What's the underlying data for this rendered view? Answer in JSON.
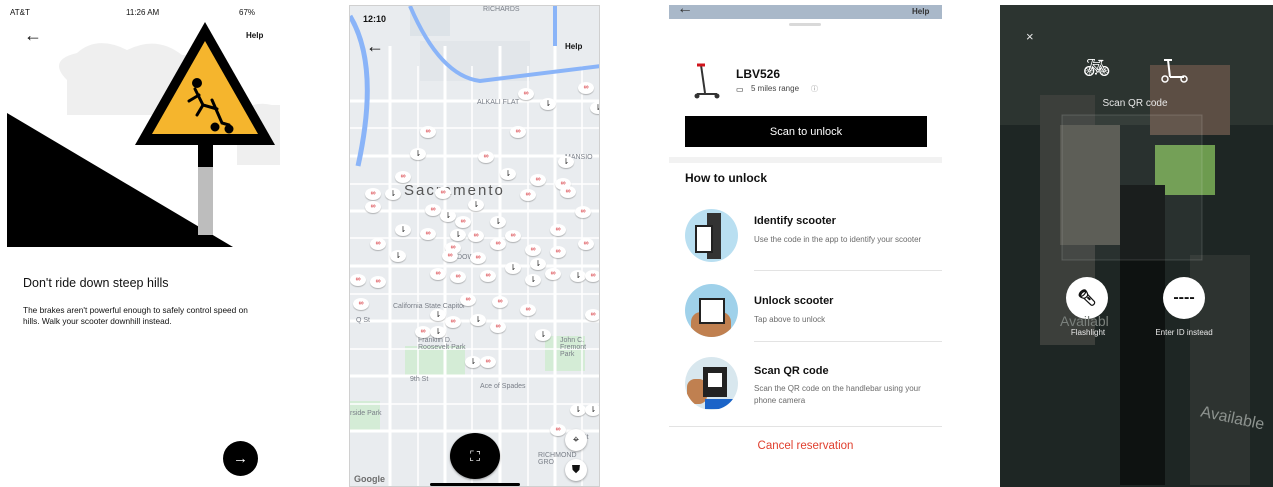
{
  "s1": {
    "status": {
      "carrier": "AT&T",
      "time": "11:26 AM",
      "battery": "67%"
    },
    "help": "Help",
    "title": "Don't ride down steep hills",
    "body": "The brakes aren't powerful enough to safely control speed on hills. Walk your scooter downhill instead.",
    "next_icon": "arrow-right-icon"
  },
  "s2": {
    "status": {
      "time": "12:10"
    },
    "help": "Help",
    "labels": {
      "richards": "RICHARDS",
      "alkali": "ALKALI FLAT",
      "mansion": "MANSIO",
      "sacramento": "Sacramento",
      "downtown": "DOWN",
      "capitol": "California State Capitol",
      "franklin": "Franklin D. Roosevelt Park",
      "fremont": "John C. Fremont Park",
      "ace": "Ace of Spades",
      "park": "rside Park",
      "richmond": "RICHMOND GRO",
      "st_q": "Q St",
      "st_9": "9th St",
      "st": "St",
      "google": "Google"
    }
  },
  "s3": {
    "plate": "LBV526",
    "range": "5 miles range",
    "scan_button": "Scan to unlock",
    "how_title": "How to unlock",
    "steps": [
      {
        "title": "Identify scooter",
        "desc": "Use the code in the app to identify your scooter"
      },
      {
        "title": "Unlock scooter",
        "desc": "Tap above to unlock"
      },
      {
        "title": "Scan QR code",
        "desc": "Scan the QR code on the handlebar using your phone camera"
      }
    ],
    "cancel": "Cancel reservation",
    "top_help": "Help"
  },
  "s4": {
    "close": "×",
    "scan_label": "Scan QR code",
    "flashlight": "Flashlight",
    "enter_id": "Enter ID instead",
    "enter_id_glyph": "----",
    "bg_text_1": "Availabl",
    "bg_text_2": "Available"
  },
  "colors": {
    "accent_red": "#e0402f",
    "sign_yellow": "#f5b52d",
    "map_bg": "#e9ecef"
  }
}
